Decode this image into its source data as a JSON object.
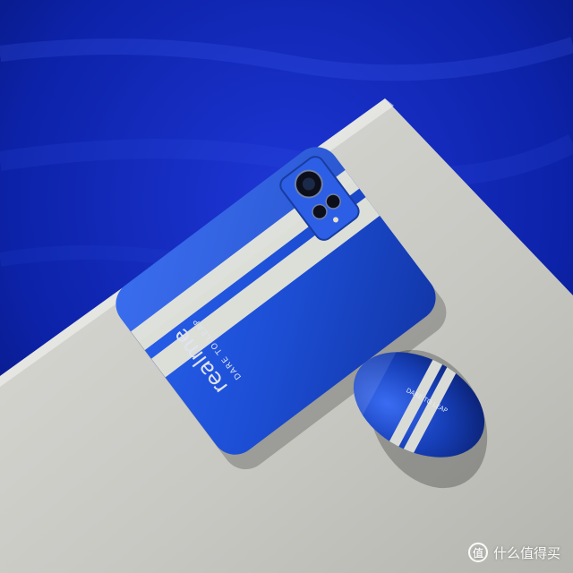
{
  "scene": {
    "phone_brand": "realme",
    "phone_slogan": "DARE TO LEAP",
    "case_slogan": "DARE TO LEAP"
  },
  "watermark": {
    "badge": "值",
    "text": "什么值得买"
  },
  "colors": {
    "background": "#0b1fa3",
    "table": "#c9c9c4",
    "phone_blue": "#1f4fd8",
    "stripe": "#d9dcd6"
  }
}
